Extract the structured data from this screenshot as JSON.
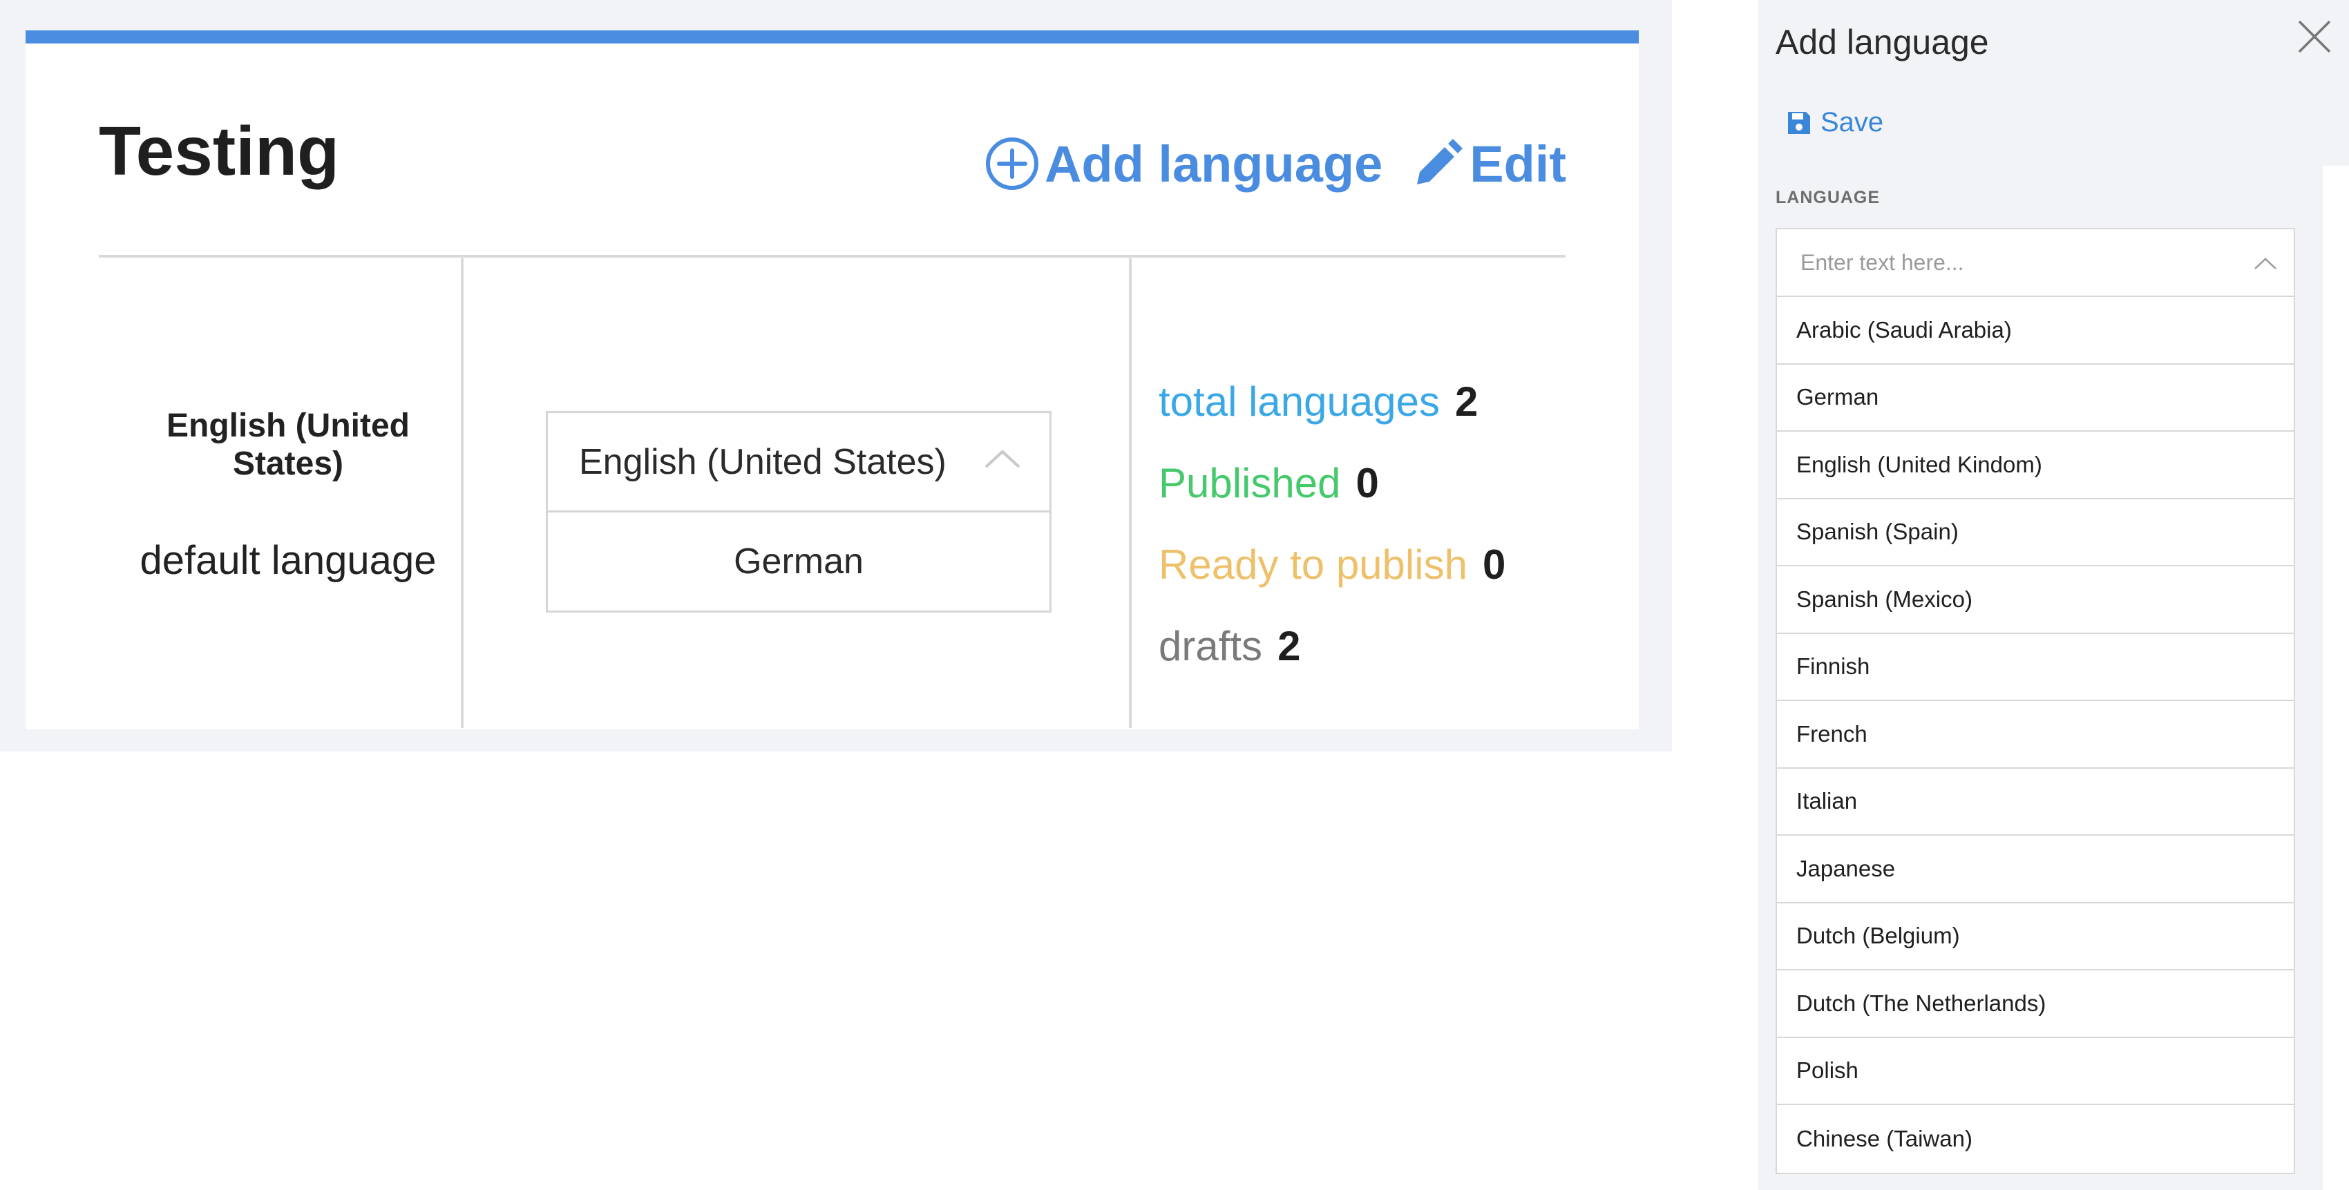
{
  "card": {
    "title": "Testing",
    "accent_color": "#4a8de0",
    "actions": {
      "add_language": "Add language",
      "add_language_icon": "plus-circle-icon",
      "edit": "Edit",
      "edit_icon": "pencil-icon"
    },
    "default_language": {
      "name": "English (United States)",
      "label": "default language"
    },
    "language_select": {
      "selected": "English (United States)",
      "options": [
        "German"
      ]
    },
    "stats": [
      {
        "label": "total languages",
        "value": "2",
        "color": "#3aa7e6"
      },
      {
        "label": "Published",
        "value": "0",
        "color": "#45c96b"
      },
      {
        "label": "Ready to publish",
        "value": "0",
        "color": "#efc06a"
      },
      {
        "label": "drafts",
        "value": "2",
        "color": "#7a7a7a"
      }
    ]
  },
  "panel": {
    "title": "Add language",
    "close_icon": "close-icon",
    "save_label": "Save",
    "save_icon": "floppy-disk-icon",
    "field_label": "LANGUAGE",
    "search_placeholder": "Enter text here...",
    "languages": [
      "Arabic (Saudi Arabia)",
      "German",
      "English (United Kindom)",
      "Spanish (Spain)",
      "Spanish (Mexico)",
      "Finnish",
      "French",
      "Italian",
      "Japanese",
      "Dutch (Belgium)",
      "Dutch (The Netherlands)",
      "Polish",
      "Chinese (Taiwan)"
    ]
  }
}
